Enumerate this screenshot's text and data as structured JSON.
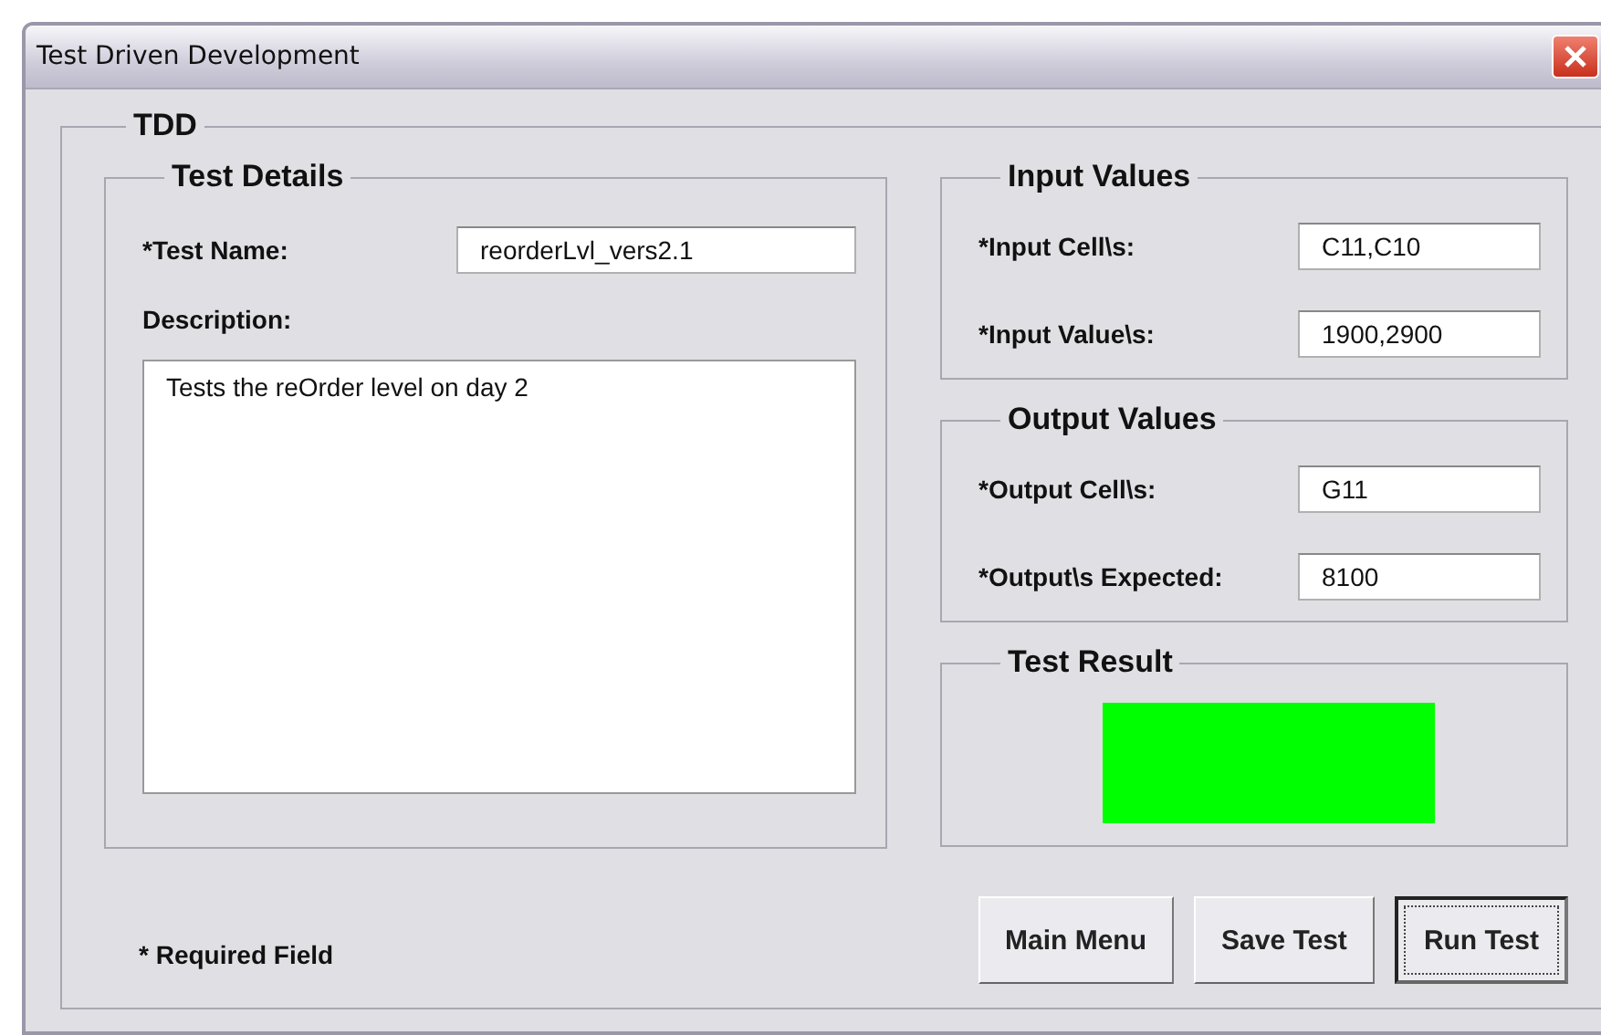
{
  "window": {
    "title": "Test Driven Development"
  },
  "group": {
    "title": "TDD"
  },
  "test_details": {
    "title": "Test Details",
    "test_name_label": "*Test Name:",
    "test_name": "reorderLvl_vers2.1",
    "description_label": "Description:",
    "description": "Tests the reOrder level on day 2"
  },
  "input_values": {
    "title": "Input Values",
    "rows": [
      {
        "label": "*Input Cell\\s:",
        "value": "C11,C10"
      },
      {
        "label": "*Input Value\\s:",
        "value": "1900,2900"
      }
    ]
  },
  "output_values": {
    "title": "Output Values",
    "rows": [
      {
        "label": "*Output Cell\\s:",
        "value": "G11"
      },
      {
        "label": "*Output\\s Expected:",
        "value": "8100"
      }
    ]
  },
  "test_result": {
    "title": "Test Result",
    "passed": true
  },
  "required_note": "* Required Field",
  "buttons": [
    {
      "label": "Main Menu",
      "default": false
    },
    {
      "label": "Save Test",
      "default": false
    },
    {
      "label": "Run Test",
      "default": true
    }
  ]
}
